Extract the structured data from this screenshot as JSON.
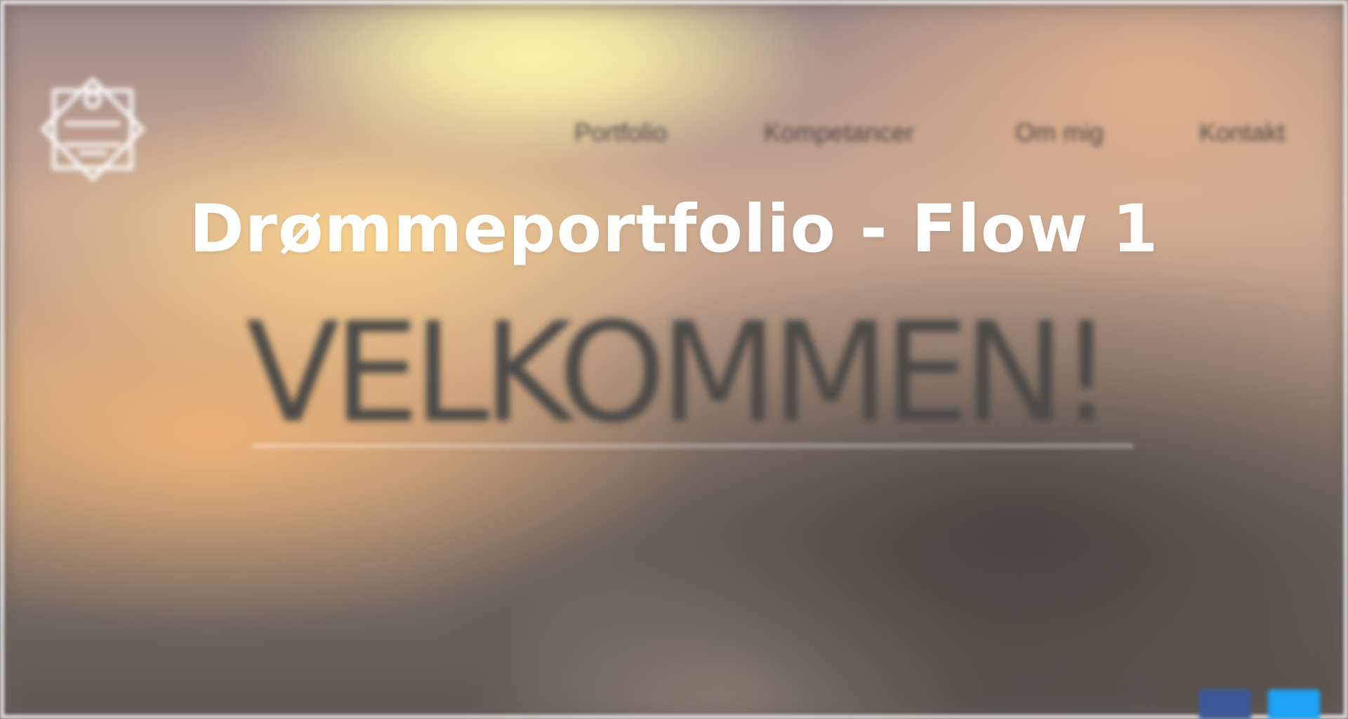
{
  "overlay": {
    "title": "Drømmeportfolio - Flow 1"
  },
  "site": {
    "logo_text": "",
    "nav": {
      "items": [
        {
          "label": "Portfolio"
        },
        {
          "label": "Kompetancer"
        },
        {
          "label": "Om mig"
        },
        {
          "label": "Kontakt"
        }
      ]
    },
    "hero": {
      "headline": "VELKOMMEN!"
    },
    "social": {
      "items": [
        {
          "icon": "facebook-icon"
        },
        {
          "icon": "twitter-icon"
        }
      ]
    }
  },
  "colors": {
    "overlay_title": "#ffffff",
    "nav_text": "#4b4744",
    "headline_text": "#4d4a47",
    "facebook": "#3b5998",
    "twitter": "#1da1f2"
  }
}
